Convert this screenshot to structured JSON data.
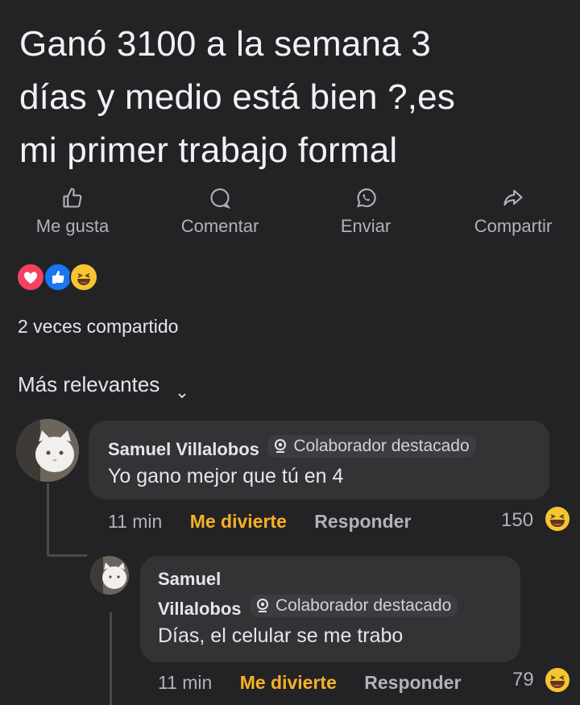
{
  "post": {
    "text": "Ganó 3100 a la semana 3\ndías y medio está bien ?,es\nmi primer trabajo formal"
  },
  "actions": [
    {
      "label": "Me gusta",
      "icon": "thumbs-up-icon"
    },
    {
      "label": "Comentar",
      "icon": "comment-icon"
    },
    {
      "label": "Enviar",
      "icon": "whatsapp-icon"
    },
    {
      "label": "Compartir",
      "icon": "share-icon"
    }
  ],
  "reactions": [
    "love",
    "like",
    "haha"
  ],
  "share_count": "2 veces compartido",
  "sort_label": "Más relevantes",
  "comments": [
    {
      "name": "Samuel Villalobos",
      "badge": "Colaborador destacado",
      "text": "Yo gano mejor que tú en 4",
      "time": "11 min",
      "laugh": "Me divierte",
      "reply": "Responder",
      "reaction_count": "150"
    },
    {
      "name_line1": "Samuel",
      "name_line2": "Villalobos",
      "badge": "Colaborador destacado",
      "text": "Días, el celular se me trabo",
      "time": "11 min",
      "laugh": "Me divierte",
      "reply": "Responder",
      "reaction_count": "79"
    }
  ],
  "colors": {
    "background": "#232325",
    "bubble": "#333336",
    "laugh_accent": "#f7b125",
    "love": "#f3425f",
    "like": "#1877f2"
  }
}
